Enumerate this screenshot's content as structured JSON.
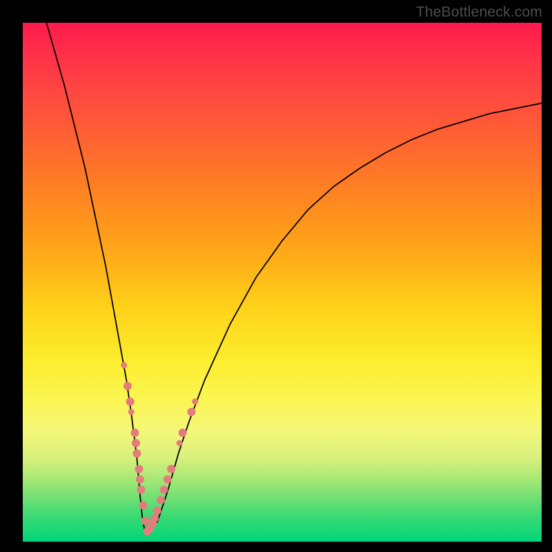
{
  "watermark": "TheBottleneck.com",
  "colors": {
    "frame": "#000000",
    "curve": "#000000",
    "marker": "#e47c7c",
    "gradient_top": "#ff1a4d",
    "gradient_bottom": "#00d67a"
  },
  "chart_data": {
    "type": "line",
    "title": "",
    "xlabel": "",
    "ylabel": "",
    "xlim": [
      0,
      100
    ],
    "ylim": [
      0,
      100
    ],
    "x": [
      4,
      8,
      12,
      16,
      18,
      20,
      21,
      22,
      22.5,
      23,
      23.5,
      24.5,
      26,
      28,
      30,
      32,
      35,
      40,
      45,
      50,
      55,
      60,
      65,
      70,
      75,
      80,
      85,
      90,
      95,
      100
    ],
    "values": [
      102,
      88,
      72,
      53,
      42,
      31,
      24,
      16,
      10,
      5,
      2,
      2,
      4,
      10,
      17,
      23,
      31,
      42,
      51,
      58,
      64,
      68.5,
      72,
      75,
      77.5,
      79.5,
      81,
      82.5,
      83.5,
      84.5
    ],
    "markers": {
      "left_branch_x": [
        19.5,
        20.2,
        20.7,
        20.9,
        21.6,
        21.8,
        22.0,
        22.4,
        22.6,
        22.8,
        23.2,
        23.6,
        24.0
      ],
      "left_branch_y": [
        34,
        30,
        27,
        25,
        21,
        19,
        17,
        14,
        12,
        10,
        7,
        4,
        2
      ],
      "right_branch_x": [
        24.5,
        25.0,
        25.4,
        25.9,
        26.6,
        27.2,
        27.9,
        28.6,
        30.2,
        30.8,
        32.5,
        33.2
      ],
      "right_branch_y": [
        2.5,
        3.5,
        4.5,
        6,
        8,
        10,
        12,
        14,
        19,
        21,
        25,
        27
      ],
      "radius_default": 6,
      "radius_small": 4.5
    }
  }
}
